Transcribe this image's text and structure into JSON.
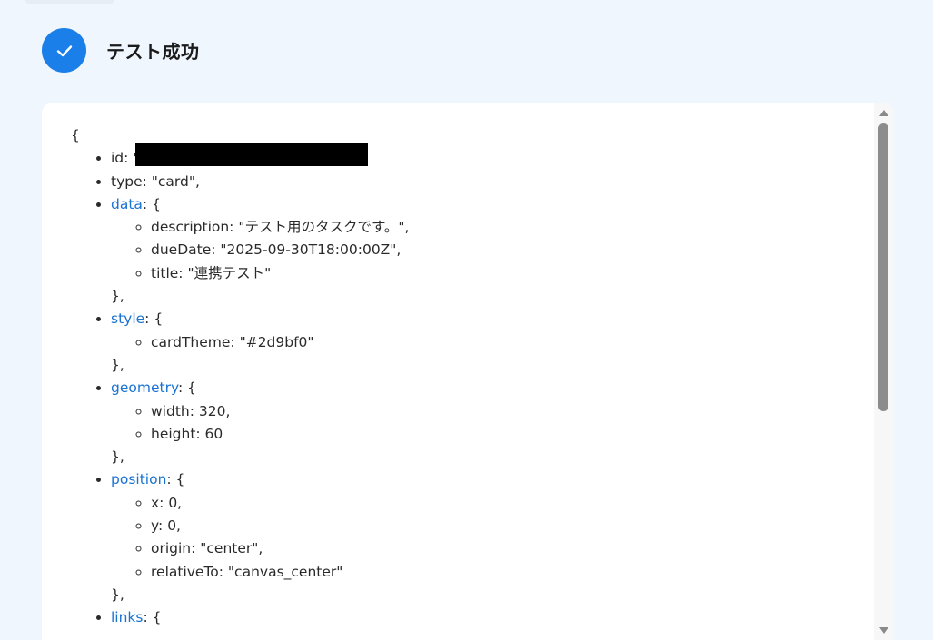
{
  "header": {
    "title": "テスト成功",
    "icon": "check-icon",
    "accent_color": "#1a7fe8"
  },
  "json_view": {
    "open_brace": "{",
    "id_line": "id: \"",
    "type_line": "type: \"card\",",
    "data": {
      "key": "data",
      "open": ": {",
      "items": [
        "description: \"テスト用のタスクです。\",",
        "dueDate: \"2025-09-30T18:00:00Z\",",
        "title: \"連携テスト\""
      ],
      "close": "},"
    },
    "style": {
      "key": "style",
      "open": ": {",
      "items": [
        "cardTheme: \"#2d9bf0\""
      ],
      "close": "},"
    },
    "geometry": {
      "key": "geometry",
      "open": ": {",
      "items": [
        "width: 320,",
        "height: 60"
      ],
      "close": "},"
    },
    "position": {
      "key": "position",
      "open": ": {",
      "items": [
        "x: 0,",
        "y: 0,",
        "origin: \"center\",",
        "relativeTo: \"canvas_center\""
      ],
      "close": "},"
    },
    "links": {
      "key": "links",
      "open": ": {"
    },
    "link_color": "#1a73d1"
  }
}
